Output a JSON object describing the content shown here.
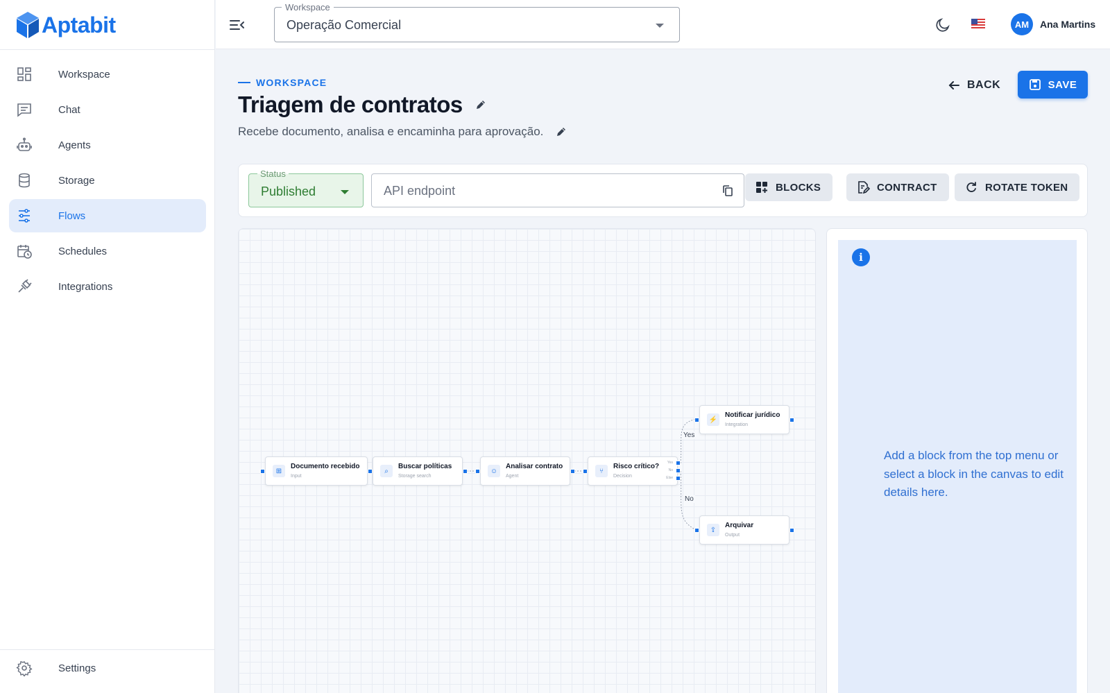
{
  "brand": {
    "name": "Aptabit"
  },
  "sidebar": {
    "items": [
      {
        "label": "Workspace",
        "icon": "dashboard-icon",
        "active": false
      },
      {
        "label": "Chat",
        "icon": "chat-icon",
        "active": false
      },
      {
        "label": "Agents",
        "icon": "robot-icon",
        "active": false
      },
      {
        "label": "Storage",
        "icon": "database-icon",
        "active": false
      },
      {
        "label": "Flows",
        "icon": "flow-icon",
        "active": true
      },
      {
        "label": "Schedules",
        "icon": "calendar-clock-icon",
        "active": false
      },
      {
        "label": "Integrations",
        "icon": "plug-icon",
        "active": false
      }
    ],
    "settings_label": "Settings"
  },
  "topbar": {
    "workspace_legend": "Workspace",
    "workspace_value": "Operação Comercial",
    "user_initials": "AM",
    "user_name": "Ana Martins",
    "language_flag": "us-flag-icon"
  },
  "header": {
    "eyebrow": "WORKSPACE",
    "title": "Triagem de contratos",
    "subtitle": "Recebe documento, analisa e encaminha para aprovação.",
    "back_label": "BACK",
    "save_label": "SAVE"
  },
  "toolbar": {
    "status_legend": "Status",
    "status_value": "Published",
    "api_placeholder": "API endpoint",
    "blocks_label": "BLOCKS",
    "contract_label": "CONTRACT",
    "rotate_label": "ROTATE TOKEN"
  },
  "canvas": {
    "nodes": [
      {
        "title": "Documento recebido",
        "type": "Input",
        "icon": "input-icon"
      },
      {
        "title": "Buscar políticas",
        "type": "Storage search",
        "icon": "search-doc-icon"
      },
      {
        "title": "Analisar contrato",
        "type": "Agent",
        "icon": "agent-icon"
      },
      {
        "title": "Risco crítico?",
        "type": "Decision",
        "icon": "branch-icon",
        "ports": [
          "Yes",
          "No",
          "Else"
        ]
      },
      {
        "title": "Notificar jurídico",
        "type": "Integration",
        "icon": "plug-icon"
      },
      {
        "title": "Arquivar",
        "type": "Output",
        "icon": "output-icon"
      }
    ],
    "edge_labels": {
      "yes": "Yes",
      "no": "No"
    }
  },
  "details": {
    "message": "Add a block from the top menu or select a block in the canvas to edit details here."
  },
  "colors": {
    "primary": "#1a73e8",
    "active_nav_bg": "#e3ecfb",
    "status_published": "#2e7d32"
  }
}
